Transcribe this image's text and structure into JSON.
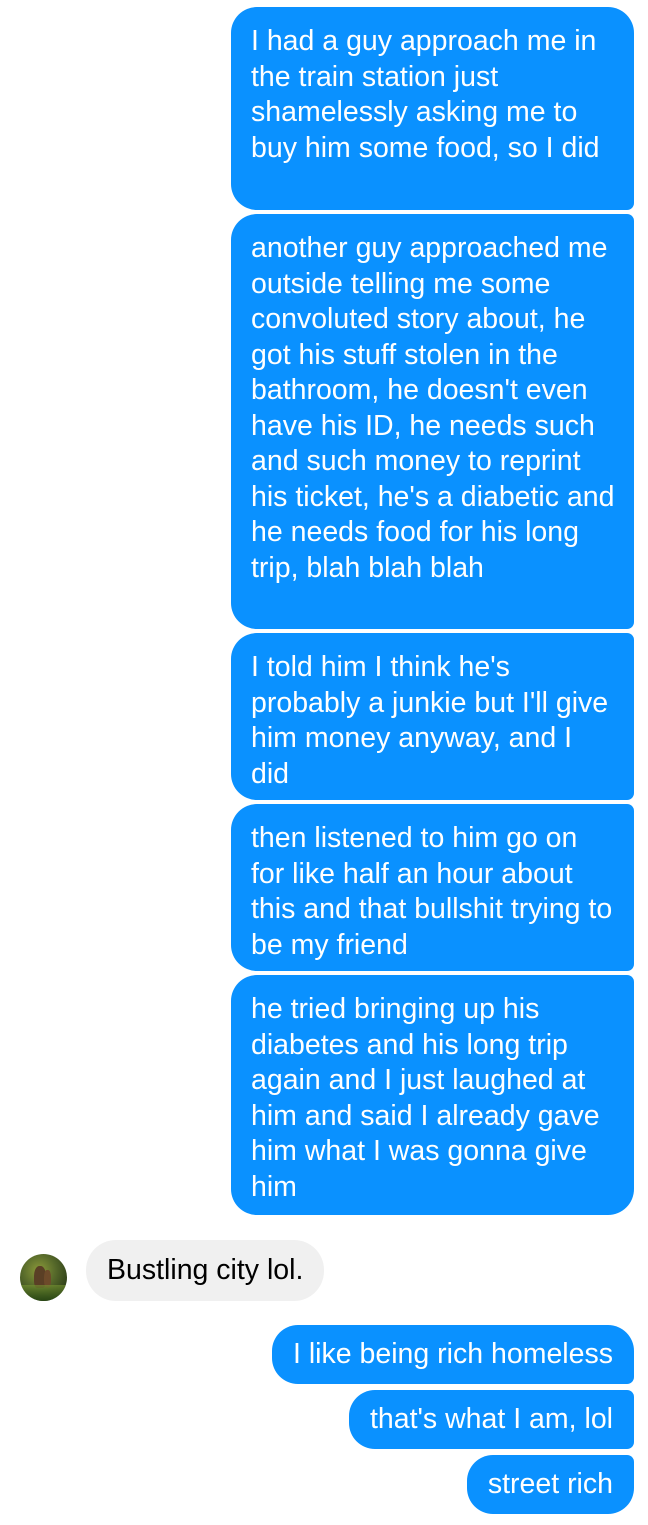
{
  "thread": {
    "messages_sent_block_1": [
      "I had a guy approach me in the train station just shamelessly asking me to buy him some food, so I did",
      "another guy approached me outside telling me some convoluted story about, he got his stuff stolen in the bathroom, he doesn't even have his ID, he needs such and such money to reprint his ticket, he's a diabetic and he needs food for his long trip, blah blah blah",
      "I told him I think he's probably a junkie but I'll give him money anyway, and I did",
      "then listened to him go on for like half an hour about this and that bullshit trying to be my friend",
      "he tried bringing up his diabetes and his long trip again and I just laughed at him and said I already gave him what I was gonna give him"
    ],
    "message_received": "Bustling city lol.",
    "messages_sent_block_2": [
      "I like being rich homeless",
      "that's what I am, lol",
      "street rich"
    ]
  },
  "colors": {
    "sent_bubble": "#0a91ff",
    "received_bubble": "#f0f0f0"
  },
  "icons": {
    "contact_avatar": "profile-photo-icon"
  }
}
